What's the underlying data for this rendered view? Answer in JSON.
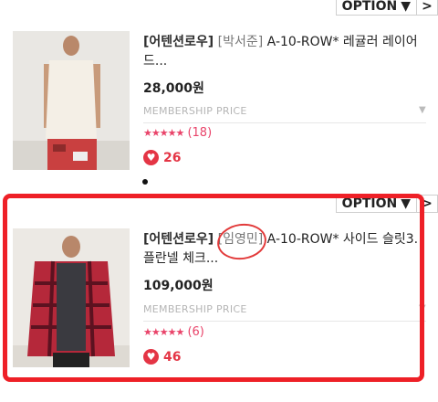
{
  "toolbar": {
    "option_label": "OPTION",
    "option_caret": "▼",
    "next_symbol": ">"
  },
  "products": [
    {
      "brand": "[어텐션로우]",
      "person": "[박서준]",
      "title_rest": " A-10-ROW* 레귤러 레이어드...",
      "price": "28,000원",
      "membership_label": "MEMBERSHIP PRICE",
      "stars": "★★★★★",
      "rating_count": "(18)",
      "like_count": "26"
    },
    {
      "brand": "[어텐션로우]",
      "person": "[임영민]",
      "title_rest": " A-10-ROW* 사이드 슬릿3. 플란넬 체크...",
      "price": "109,000원",
      "membership_label": "MEMBERSHIP PRICE",
      "stars": "★★★★★",
      "rating_count": "(6)",
      "like_count": "46"
    }
  ],
  "colors": {
    "accent_red": "#ee2027",
    "star_pink": "#e9446a",
    "heart_red": "#e43545"
  }
}
